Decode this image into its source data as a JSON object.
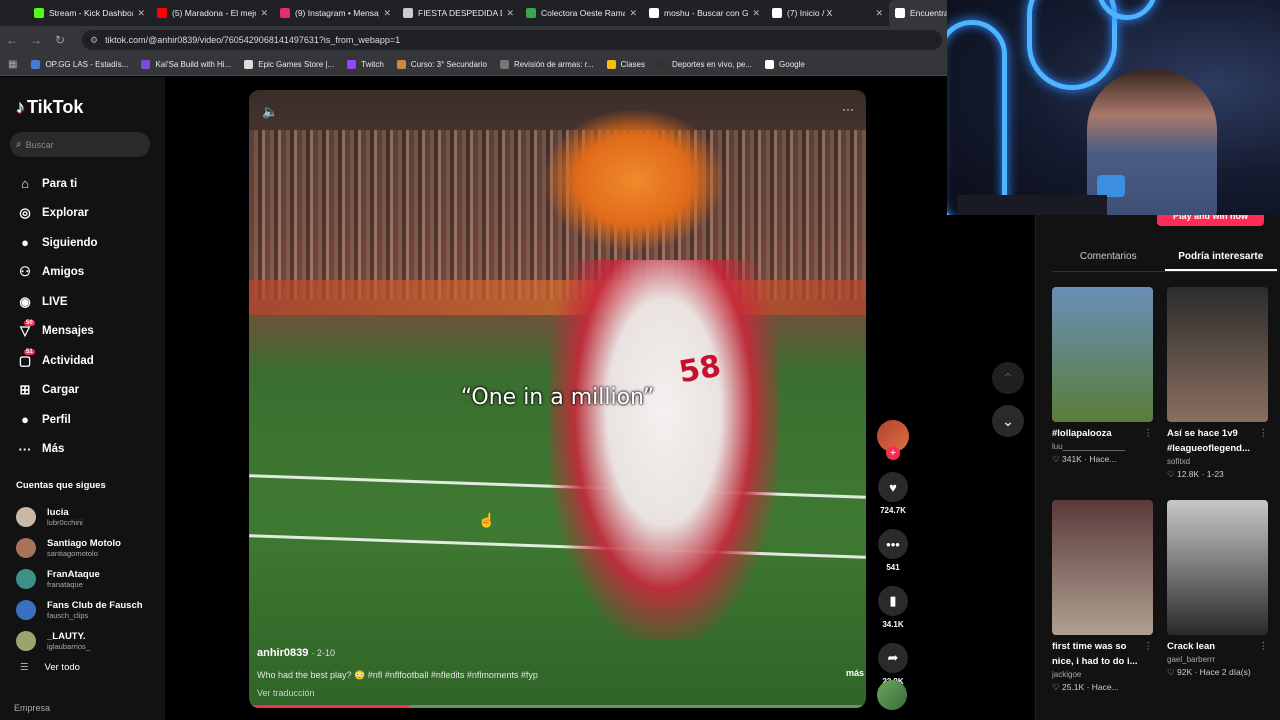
{
  "browser": {
    "tabs": [
      {
        "title": "Stream - Kick Dashboard",
        "color": "#53fc18",
        "active": false
      },
      {
        "title": "(5) Maradona - El mejor",
        "color": "#ff0000",
        "active": false
      },
      {
        "title": "(9) Instagram • Mensajes",
        "color": "#e1306c",
        "active": false
      },
      {
        "title": "FIESTA DESPEDIDA DE",
        "color": "#cccccc",
        "active": false
      },
      {
        "title": "Colectora Oeste Ramal",
        "color": "#34a853",
        "active": false
      },
      {
        "title": "moshu - Buscar con Google",
        "color": "#ffffff",
        "active": false
      },
      {
        "title": "(7) Inicio / X",
        "color": "#ffffff",
        "active": false
      },
      {
        "title": "Encuentra",
        "color": "#ffffff",
        "active": true
      }
    ],
    "url": "tiktok.com/@anhir0839/video/7605429068141497631?is_from_webapp=1",
    "bookmarks": [
      {
        "label": "OP.GG LAS - Estadís...",
        "color": "#4a7ad9"
      },
      {
        "label": "Kai'Sa Build with Hi...",
        "color": "#7a4ad9"
      },
      {
        "label": "Epic Games Store |...",
        "color": "#dddddd"
      },
      {
        "label": "Twitch",
        "color": "#9146ff"
      },
      {
        "label": "Curso: 3° Secundario",
        "color": "#c98a3a"
      },
      {
        "label": "Revisión de armas: r...",
        "color": "#777777"
      },
      {
        "label": "Clases",
        "color": "#f4c20d"
      },
      {
        "label": "Deportes en vivo, pe...",
        "color": "#333333"
      },
      {
        "label": "Google",
        "color": "#ffffff"
      }
    ]
  },
  "sidebar": {
    "logo": "TikTok",
    "search_placeholder": "Buscar",
    "nav": [
      {
        "label": "Para ti",
        "icon": "home-icon",
        "glyph": "⌂",
        "badge": ""
      },
      {
        "label": "Explorar",
        "icon": "compass-icon",
        "glyph": "◎",
        "badge": ""
      },
      {
        "label": "Siguiendo",
        "icon": "following-avatar-icon",
        "glyph": "●",
        "badge": ""
      },
      {
        "label": "Amigos",
        "icon": "friends-icon",
        "glyph": "⚇",
        "badge": ""
      },
      {
        "label": "LIVE",
        "icon": "live-icon",
        "glyph": "◉",
        "badge": ""
      },
      {
        "label": "Mensajes",
        "icon": "messages-icon",
        "glyph": "▽",
        "badge": "50"
      },
      {
        "label": "Actividad",
        "icon": "activity-icon",
        "glyph": "▢",
        "badge": "51"
      },
      {
        "label": "Cargar",
        "icon": "upload-icon",
        "glyph": "⊞",
        "badge": ""
      },
      {
        "label": "Perfil",
        "icon": "profile-icon",
        "glyph": "●",
        "badge": ""
      },
      {
        "label": "Más",
        "icon": "more-icon",
        "glyph": "···",
        "badge": ""
      }
    ],
    "following_title": "Cuentas que sigues",
    "following": [
      {
        "name": "lucia",
        "user": "lubr0cchini",
        "color": "#c9b7a8"
      },
      {
        "name": "Santiago Motolo",
        "user": "santiagomotolo",
        "color": "#a87258"
      },
      {
        "name": "FranAtaque",
        "user": "franataque",
        "color": "#3d8f8a"
      },
      {
        "name": "Fans Club de Fausch",
        "user": "fausch_clips",
        "color": "#3a6fc1"
      },
      {
        "name": "_LAUTY.",
        "user": "iglaubarrios_",
        "color": "#9da36d"
      }
    ],
    "see_all": "Ver todo",
    "footer": "Empresa"
  },
  "video": {
    "caption": "“One in a million”",
    "jersey": "58",
    "author": "anhir0839",
    "date": "· 2-10",
    "description": "Who had the best play? 😳 #nfl #nflfootball #nfledits #nflmoments #fyp",
    "translate": "Ver traducción",
    "more": "más",
    "progress": 0.26
  },
  "actions": {
    "likes": "724.7K",
    "comments": "541",
    "saves": "34.1K",
    "shares": "22.9K"
  },
  "right_panel": {
    "play_button": "Play and win now",
    "tabs": [
      "Comentarios",
      "Podría interesarte"
    ],
    "active_tab": 1,
    "cards": [
      {
        "title": "#lollapalooza",
        "user": "luu______________",
        "likes": "341K",
        "when": "Hace...",
        "c1": "#6a8fb8",
        "c2": "#5a7d3a"
      },
      {
        "title": "Así se hace 1v9 #leagueoflegend...",
        "user": "sofitxd",
        "likes": "12.8K",
        "when": "1-23",
        "c1": "#2c2c2c",
        "c2": "#8a6f5f"
      },
      {
        "title": "first time was so nice, i had to do i...",
        "user": "jackigoe",
        "likes": "25.1K",
        "when": "Hace...",
        "c1": "#5a3a3a",
        "c2": "#b0a090"
      },
      {
        "title": "Crack lean",
        "user": "gael_barberrr",
        "likes": "92K",
        "when": "Hace 2 día(s)",
        "c1": "#c8c8c8",
        "c2": "#2a2a2a"
      }
    ]
  }
}
